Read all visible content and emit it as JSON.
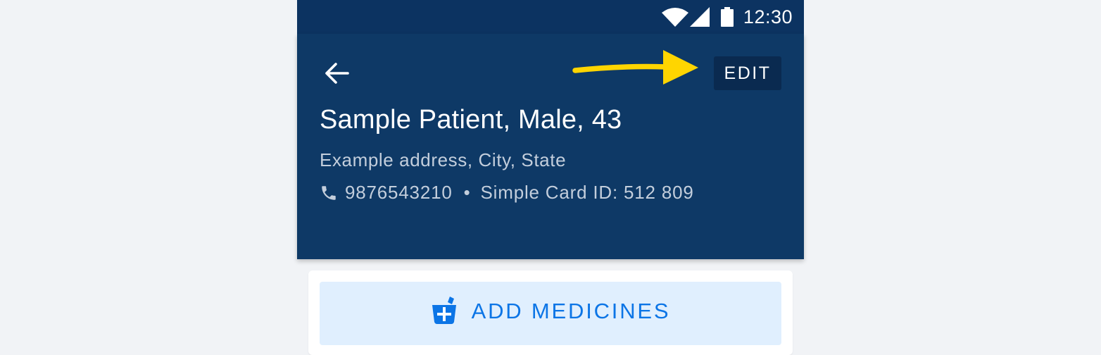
{
  "status_bar": {
    "time": "12:30",
    "icons": [
      "wifi-icon",
      "cellular-signal-icon",
      "battery-icon"
    ]
  },
  "header": {
    "back_icon": "arrow-back-icon",
    "edit_label": "EDIT",
    "annotation": "yellow-arrow-pointing-to-edit",
    "patient_title": "Sample Patient, Male, 43",
    "address": "Example address, City, State",
    "phone_icon": "phone-icon",
    "phone_number": "9876543210",
    "separator": "•",
    "card_id": "Simple Card ID: 512 809"
  },
  "actions": {
    "add_medicines_icon": "medicine-mortar-icon",
    "add_medicines_label": "ADD MEDICINES"
  },
  "colors": {
    "background": "#F1F3F6",
    "status_bar": "#0C3361",
    "header": "#0E3966",
    "edit_button": "#0A2A50",
    "annotation_arrow": "#FFD500",
    "secondary_text": "#C3CEDC",
    "accent": "#0C75E6",
    "button_light": "#E0EFFE"
  }
}
